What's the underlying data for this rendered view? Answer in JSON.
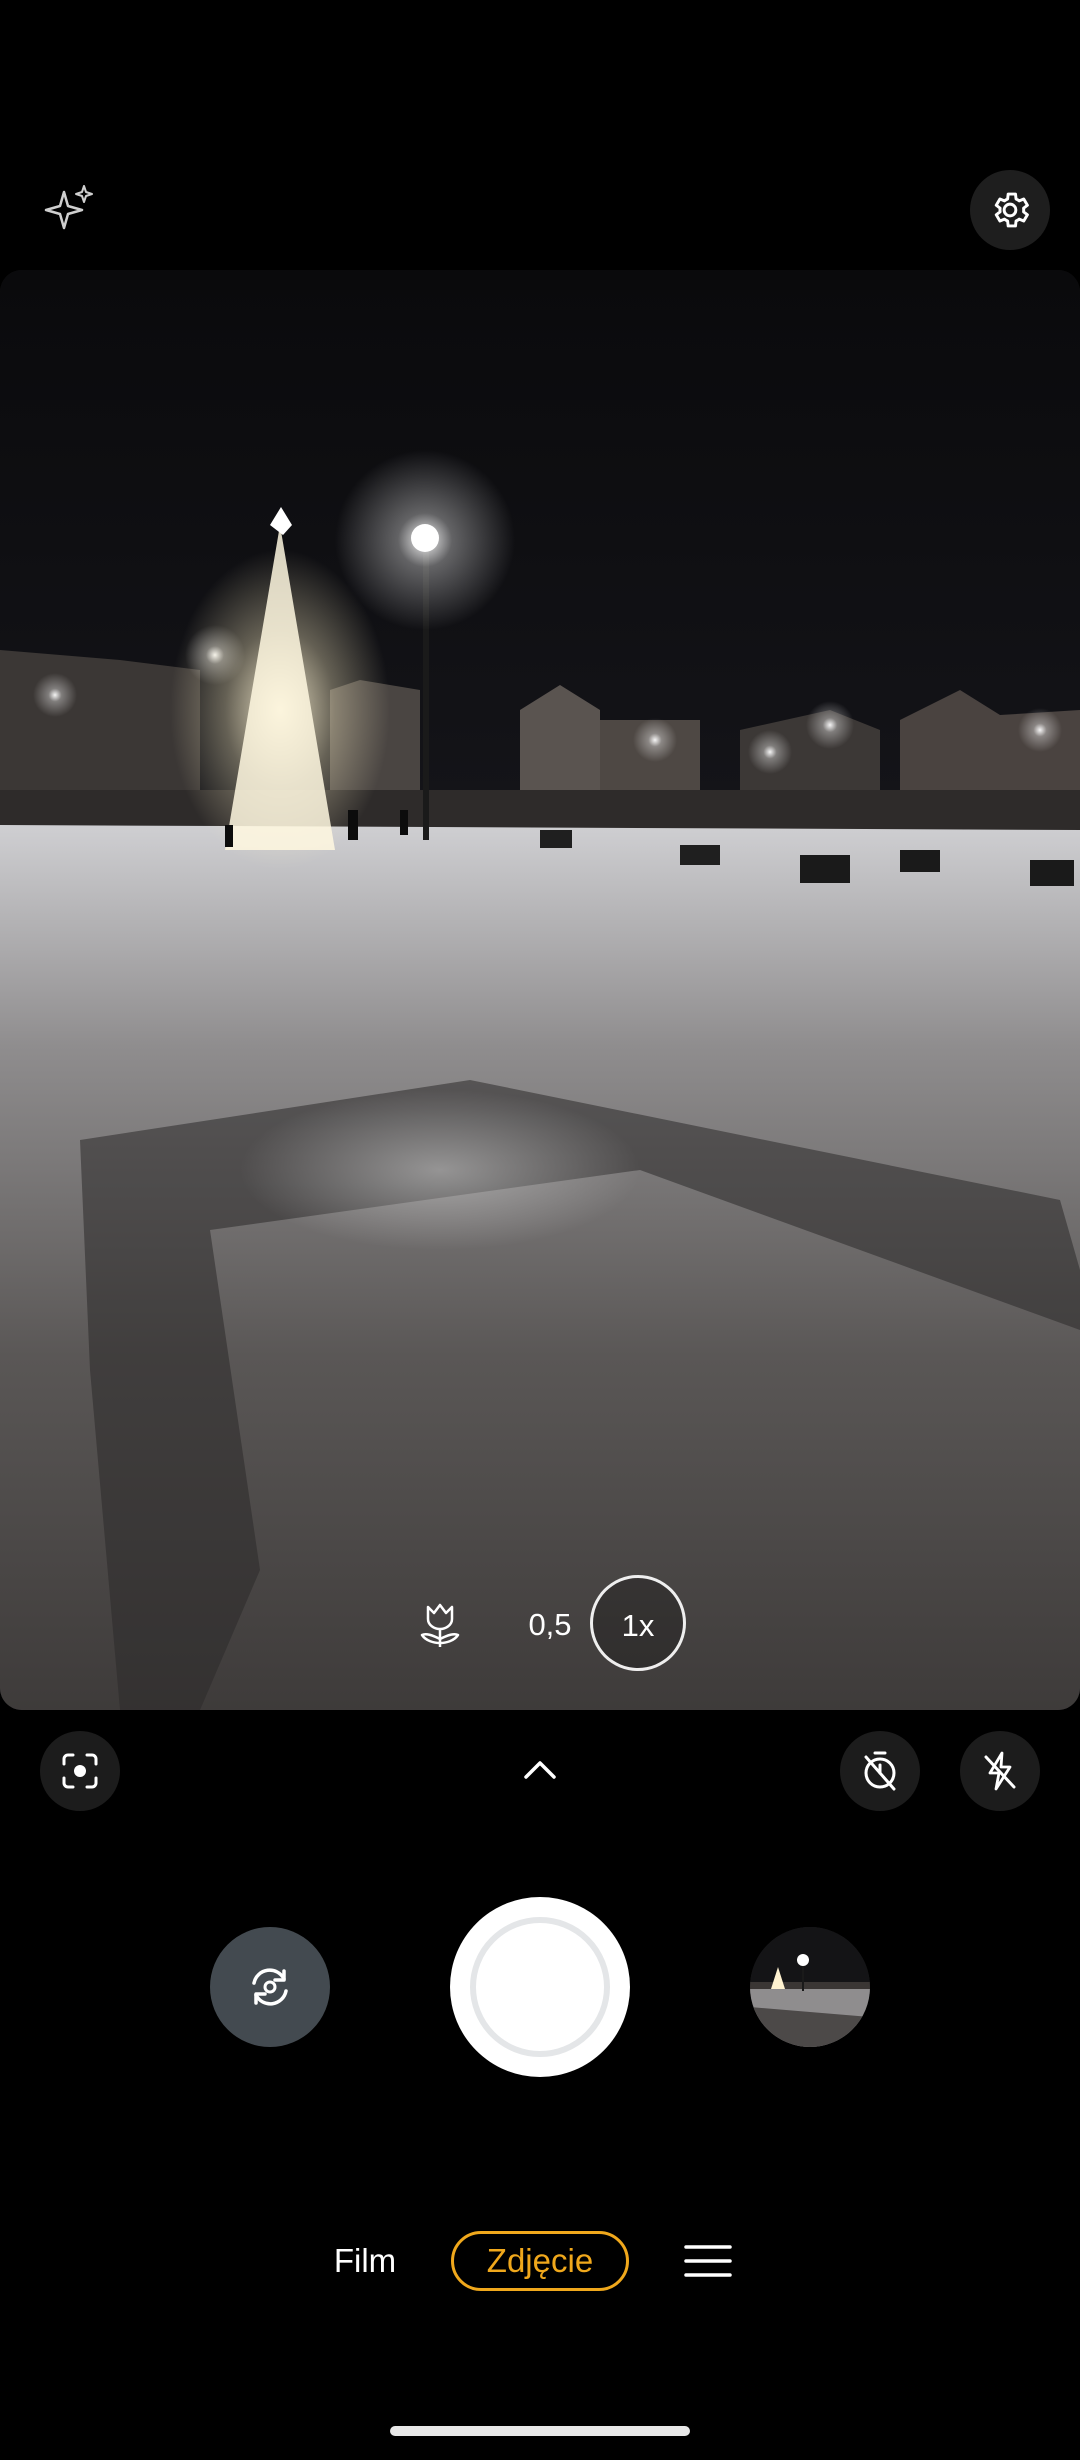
{
  "top_bar": {
    "sparkle_icon": "sparkle-icon",
    "settings_icon": "gear-icon"
  },
  "zoom": {
    "macro_icon": "tulip-icon",
    "option_wide": "0,5",
    "option_main": "1x",
    "selected": "1x"
  },
  "controls": {
    "lens_icon": "lens-scan-icon",
    "expand_icon": "chevron-up-icon",
    "timer_icon": "timer-off-icon",
    "flash_icon": "flash-off-icon"
  },
  "shutter_row": {
    "switch_icon": "camera-switch-icon",
    "shutter": "shutter-button",
    "gallery": "gallery-thumbnail"
  },
  "modes": {
    "film": "Film",
    "photo": "Zdjęcie",
    "active": "Zdjęcie",
    "menu_icon": "menu-icon"
  },
  "colors": {
    "accent": "#f0a81c",
    "background": "#000000",
    "control_bg": "#1c1c1c",
    "switch_bg": "#434a50"
  }
}
